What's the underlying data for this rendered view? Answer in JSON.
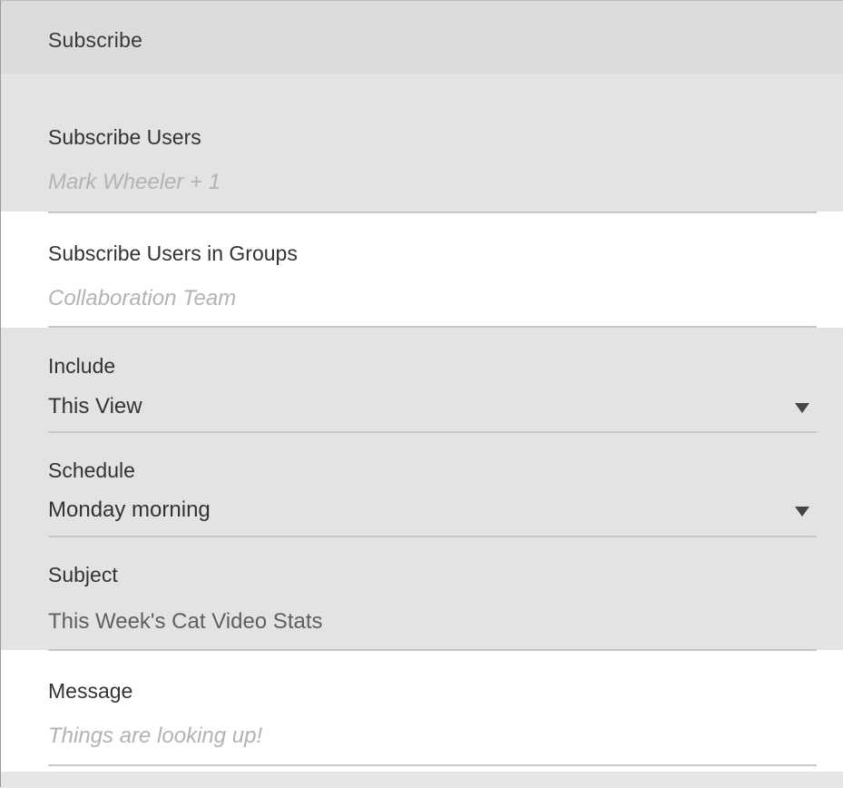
{
  "header": {
    "title": "Subscribe"
  },
  "subscribe_users": {
    "label": "Subscribe Users",
    "value": "Mark Wheeler + 1"
  },
  "subscribe_groups": {
    "label": "Subscribe Users in Groups",
    "value": "Collaboration Team"
  },
  "include": {
    "label": "Include",
    "value": "This View"
  },
  "schedule": {
    "label": "Schedule",
    "value": "Monday morning"
  },
  "subject": {
    "label": "Subject",
    "value": "This Week's Cat Video Stats"
  },
  "message": {
    "label": "Message",
    "placeholder": "Things are looking up!"
  },
  "icons": {
    "dropdown": "caret-down-icon"
  }
}
